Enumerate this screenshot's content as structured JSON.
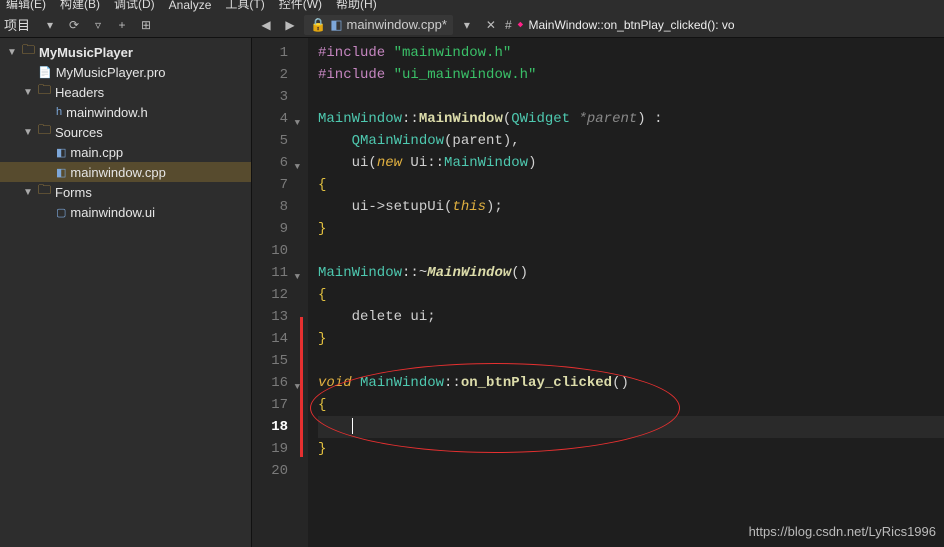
{
  "menu": [
    "编辑(E)",
    "构建(B)",
    "调试(D)",
    "Analyze",
    "工具(T)",
    "控件(W)",
    "帮助(H)"
  ],
  "sidebar_label": "项目",
  "breadcrumb": {
    "filename": "mainwindow.cpp*",
    "sep": "#",
    "func": "MainWindow::on_btnPlay_clicked(): vo"
  },
  "tree": {
    "project": "MyMusicPlayer",
    "pro_file": "MyMusicPlayer.pro",
    "headers": "Headers",
    "header1": "mainwindow.h",
    "sources": "Sources",
    "source1": "main.cpp",
    "source2": "mainwindow.cpp",
    "forms": "Forms",
    "form1": "mainwindow.ui"
  },
  "lines": [
    "1",
    "2",
    "3",
    "4",
    "5",
    "6",
    "7",
    "8",
    "9",
    "10",
    "11",
    "12",
    "13",
    "14",
    "15",
    "16",
    "17",
    "18",
    "19",
    "20"
  ],
  "code": {
    "l1_pp": "#include ",
    "l1_str": "\"mainwindow.h\"",
    "l2_pp": "#include ",
    "l2_str": "\"ui_mainwindow.h\"",
    "l4_cls": "MainWindow",
    "l4_sep": "::",
    "l4_fn": "MainWindow",
    "l4_args_open": "(",
    "l4_qw": "QWidget",
    "l4_param": " *parent",
    "l4_close": ") :",
    "l5_pre": "    ",
    "l5_cls": "QMainWindow",
    "l5_args": "(parent),",
    "l6_pre": "    ui(",
    "l6_new": "new",
    "l6_sp": " Ui::",
    "l6_cls": "MainWindow",
    "l6_end": ")",
    "l7": "{",
    "l8_pre": "    ui->setupUi(",
    "l8_this": "this",
    "l8_end": ");",
    "l9": "}",
    "l11_cls": "MainWindow",
    "l11_sep": "::~",
    "l11_fn": "MainWindow",
    "l11_end": "()",
    "l12": "{",
    "l13": "    delete ui;",
    "l14": "}",
    "l16_void": "void",
    "l16_sp": " ",
    "l16_cls": "MainWindow",
    "l16_sep": "::",
    "l16_fn": "on_btnPlay_clicked",
    "l16_end": "()",
    "l17": "{",
    "l19": "}"
  },
  "watermark": "https://blog.csdn.net/LyRics1996"
}
